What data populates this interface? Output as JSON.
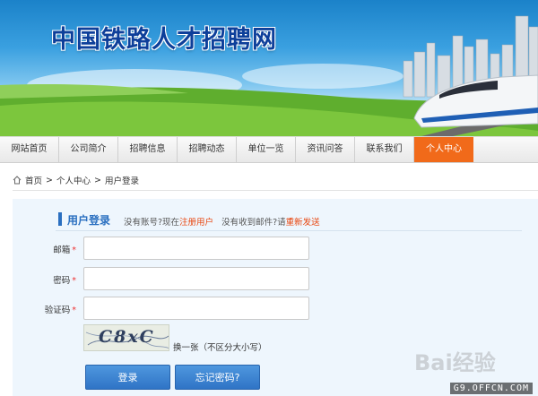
{
  "header": {
    "site_title": "中国铁路人才招聘网"
  },
  "nav": {
    "items": [
      "网站首页",
      "公司简介",
      "招聘信息",
      "招聘动态",
      "单位一览",
      "资讯问答",
      "联系我们",
      "个人中心"
    ],
    "active_color": "#f16a1a"
  },
  "breadcrumb": {
    "home": "首页",
    "sep": ">",
    "level1": "个人中心",
    "level2": "用户登录"
  },
  "login": {
    "title": "用户登录",
    "tip_no_account": "没有账号?现在",
    "tip_register": "注册用户",
    "tip_no_mail": "没有收到邮件?请",
    "tip_resend": "重新发送",
    "email_label": "邮箱",
    "password_label": "密码",
    "captcha_label": "验证码",
    "required_mark": "*",
    "email_value": "",
    "password_value": "",
    "captcha_value": "",
    "captcha_image_text": "C8xC",
    "refresh_text": "换一张（不区分大小写）",
    "login_button": "登录",
    "forgot_button": "忘记密码?"
  },
  "watermark": {
    "site": "G9.OFFCN.COM",
    "baidu": "Bai经验"
  },
  "colors": {
    "brand_blue": "#2a6fc0",
    "accent_orange": "#f16a1a"
  }
}
